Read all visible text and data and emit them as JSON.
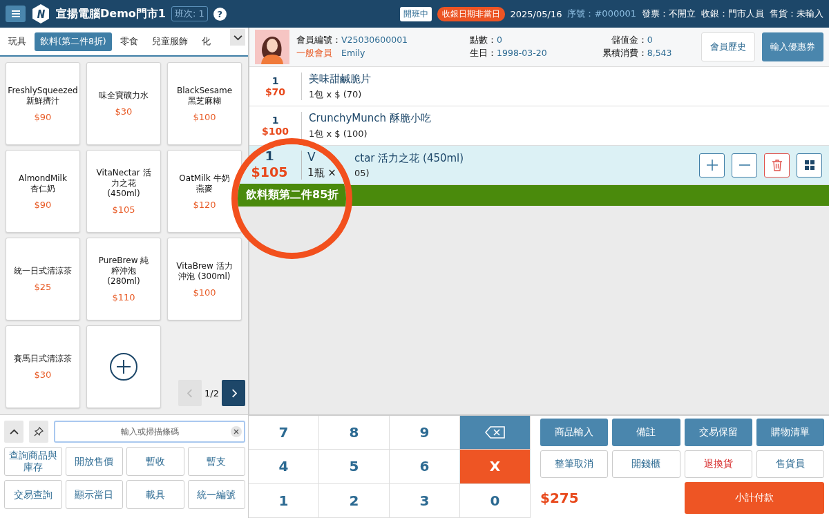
{
  "header": {
    "store_name": "宣揚電腦Demo門市1",
    "shift": "班次: 1",
    "help": "?",
    "shift_status": "開班中",
    "date_warning": "收銀日期非當日",
    "date": "2025/05/16",
    "serial": "序號：#000001",
    "invoice": "發票：不開立",
    "cashier": "收銀：門市人員",
    "seller": "售貨：未輸入"
  },
  "tabs": [
    {
      "label": "玩具",
      "selected": false
    },
    {
      "label": "飲料(第二件8折)",
      "selected": true
    },
    {
      "label": "零食",
      "selected": false
    },
    {
      "label": "兒童服飾",
      "selected": false
    },
    {
      "label": "化",
      "selected": false
    }
  ],
  "products": [
    {
      "name": "FreshlySqueezed 新鮮擠汁",
      "price": "$90"
    },
    {
      "name": "味全寶礦力水",
      "price": "$30"
    },
    {
      "name": "BlackSesame 黑芝麻糊",
      "price": "$100"
    },
    {
      "name": "AlmondMilk 杏仁奶",
      "price": "$90"
    },
    {
      "name": "VitaNectar 活力之花 (450ml)",
      "price": "$105"
    },
    {
      "name": "OatMilk 牛奶燕麥",
      "price": "$120"
    },
    {
      "name": "統一日式清涼茶",
      "price": "$25"
    },
    {
      "name": "PureBrew 純粹沖泡 (280ml)",
      "price": "$110"
    },
    {
      "name": "VitaBrew 活力沖泡 (300ml)",
      "price": "$100"
    },
    {
      "name": "賽馬日式清涼茶",
      "price": "$30"
    }
  ],
  "pager": {
    "page": "1/2",
    "prev_disabled": true
  },
  "search": {
    "placeholder": "輸入或掃描條碼"
  },
  "left_buttons": [
    "查詢商品與庫存",
    "開放售價",
    "暫收",
    "暫支",
    "交易查詢",
    "顯示當日",
    "載具",
    "統一編號"
  ],
  "member": {
    "id_label": "會員編號：",
    "id": "V25030600001",
    "level": "一般會員",
    "name": "Emily",
    "points_label": "點數：",
    "points": "0",
    "birthday_label": "生日：",
    "birthday": "1998-03-20",
    "stored_label": "儲值金：",
    "stored": "0",
    "spent_label": "累積消費：",
    "spent": "8,543",
    "history_button": "會員歷史",
    "coupon_button": "輸入優惠券"
  },
  "cart": [
    {
      "qty": "1",
      "price": "$70",
      "name": "美味甜鹹脆片",
      "detail": "1包 x $ (70)",
      "selected": false,
      "partly_hidden": false
    },
    {
      "qty": "1",
      "price": "$100",
      "name": "CrunchyMunch 酥脆小吃",
      "detail": "1包 x $ (100)",
      "selected": false,
      "partly_hidden": false
    },
    {
      "name": "ctar 活力之花 (450ml)",
      "detail": "05)",
      "selected": true,
      "partly_hidden": true
    }
  ],
  "promo_banner": true,
  "lens": {
    "qty": "1",
    "price": "$105",
    "name": "V",
    "detail": "1瓶 ×",
    "banner": "飲料類第二件85折"
  },
  "keypad": [
    {
      "kind": "digit",
      "label": "7"
    },
    {
      "kind": "digit",
      "label": "8"
    },
    {
      "kind": "digit",
      "label": "9"
    },
    {
      "kind": "backspace"
    },
    {
      "kind": "digit",
      "label": "4"
    },
    {
      "kind": "digit",
      "label": "5"
    },
    {
      "kind": "digit",
      "label": "6"
    },
    {
      "kind": "clear",
      "label": "X"
    },
    {
      "kind": "digit",
      "label": "1"
    },
    {
      "kind": "digit",
      "label": "2"
    },
    {
      "kind": "digit",
      "label": "3"
    },
    {
      "kind": "digit",
      "label": "0"
    }
  ],
  "functions": [
    {
      "label": "商品輸入",
      "kind": "primary"
    },
    {
      "label": "備註",
      "kind": "primary"
    },
    {
      "label": "交易保留",
      "kind": "primary"
    },
    {
      "label": "購物清單",
      "kind": "primary"
    },
    {
      "label": "整筆取消",
      "kind": "outline"
    },
    {
      "label": "開錢櫃",
      "kind": "outline"
    },
    {
      "label": "退換貨",
      "kind": "danger"
    },
    {
      "label": "售貨員",
      "kind": "outline"
    }
  ],
  "total": "$275",
  "pay_button": "小計付款"
}
